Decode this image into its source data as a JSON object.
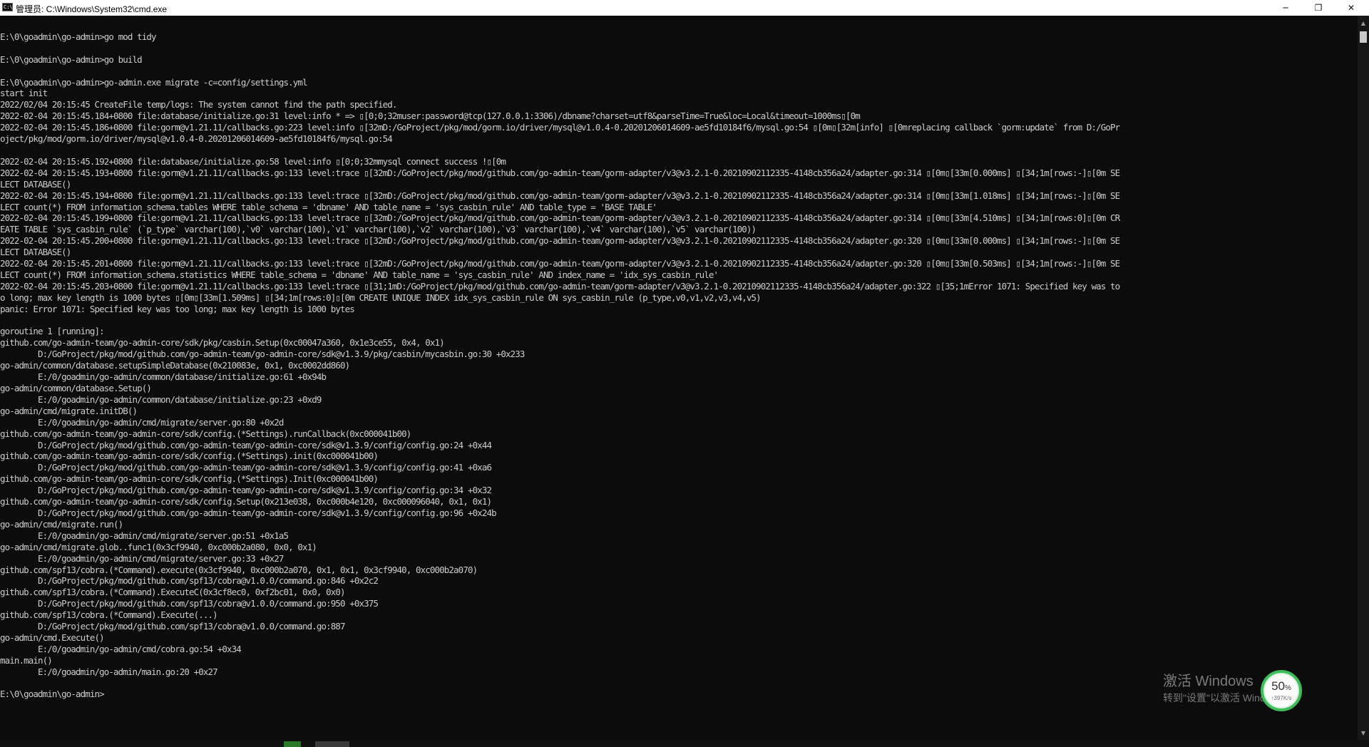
{
  "window": {
    "title": "管理员: C:\\Windows\\System32\\cmd.exe",
    "icon": "cmd-icon",
    "icon_text": "C:\\",
    "controls": {
      "minimize": "─",
      "maximize": "❐",
      "close": "✕"
    }
  },
  "console": {
    "lines": [
      "",
      "E:\\0\\goadmin\\go-admin>go mod tidy",
      "",
      "E:\\0\\goadmin\\go-admin>go build",
      "",
      "E:\\0\\goadmin\\go-admin>go-admin.exe migrate -c=config/settings.yml",
      "start init",
      "2022/02/04 20:15:45 CreateFile temp/logs: The system cannot find the path specified.",
      "2022-02-04 20:15:45.184+0800 file:database/initialize.go:31 level:info * => \u001b[0;0;32muser:password@tcp(127.0.0.1:3306)/dbname?charset=utf8&parseTime=True&loc=Local&timeout=1000ms\u001b[0m",
      "2022-02-04 20:15:45.186+0800 file:gorm@v1.21.11/callbacks.go:223 level:info \u001b[32mD:/GoProject/pkg/mod/gorm.io/driver/mysql@v1.0.4-0.20201206014609-ae5fd10184f6/mysql.go:54 \u001b[0m\u001b[32m[info] \u001b[0mreplacing callback `gorm:update` from D:/GoPr",
      "oject/pkg/mod/gorm.io/driver/mysql@v1.0.4-0.20201206014609-ae5fd10184f6/mysql.go:54",
      "",
      "2022-02-04 20:15:45.192+0800 file:database/initialize.go:58 level:info \u001b[0;0;32mmysql connect success !\u001b[0m",
      "2022-02-04 20:15:45.193+0800 file:gorm@v1.21.11/callbacks.go:133 level:trace \u001b[32mD:/GoProject/pkg/mod/github.com/go-admin-team/gorm-adapter/v3@v3.2.1-0.20210902112335-4148cb356a24/adapter.go:314 \u001b[0m\u001b[33m[0.000ms] \u001b[34;1m[rows:-]\u001b[0m SE",
      "LECT DATABASE()",
      "2022-02-04 20:15:45.194+0800 file:gorm@v1.21.11/callbacks.go:133 level:trace \u001b[32mD:/GoProject/pkg/mod/github.com/go-admin-team/gorm-adapter/v3@v3.2.1-0.20210902112335-4148cb356a24/adapter.go:314 \u001b[0m\u001b[33m[1.018ms] \u001b[34;1m[rows:-]\u001b[0m SE",
      "LECT count(*) FROM information_schema.tables WHERE table_schema = 'dbname' AND table_name = 'sys_casbin_rule' AND table_type = 'BASE TABLE'",
      "2022-02-04 20:15:45.199+0800 file:gorm@v1.21.11/callbacks.go:133 level:trace \u001b[32mD:/GoProject/pkg/mod/github.com/go-admin-team/gorm-adapter/v3@v3.2.1-0.20210902112335-4148cb356a24/adapter.go:314 \u001b[0m\u001b[33m[4.510ms] \u001b[34;1m[rows:0]\u001b[0m CR",
      "EATE TABLE `sys_casbin_rule` (`p_type` varchar(100),`v0` varchar(100),`v1` varchar(100),`v2` varchar(100),`v3` varchar(100),`v4` varchar(100),`v5` varchar(100))",
      "2022-02-04 20:15:45.200+0800 file:gorm@v1.21.11/callbacks.go:133 level:trace \u001b[32mD:/GoProject/pkg/mod/github.com/go-admin-team/gorm-adapter/v3@v3.2.1-0.20210902112335-4148cb356a24/adapter.go:320 \u001b[0m\u001b[33m[0.000ms] \u001b[34;1m[rows:-]\u001b[0m SE",
      "LECT DATABASE()",
      "2022-02-04 20:15:45.201+0800 file:gorm@v1.21.11/callbacks.go:133 level:trace \u001b[32mD:/GoProject/pkg/mod/github.com/go-admin-team/gorm-adapter/v3@v3.2.1-0.20210902112335-4148cb356a24/adapter.go:320 \u001b[0m\u001b[33m[0.503ms] \u001b[34;1m[rows:-]\u001b[0m SE",
      "LECT count(*) FROM information_schema.statistics WHERE table_schema = 'dbname' AND table_name = 'sys_casbin_rule' AND index_name = 'idx_sys_casbin_rule'",
      "2022-02-04 20:15:45.203+0800 file:gorm@v1.21.11/callbacks.go:133 level:trace \u001b[31;1mD:/GoProject/pkg/mod/github.com/go-admin-team/gorm-adapter/v3@v3.2.1-0.20210902112335-4148cb356a24/adapter.go:322 \u001b[35;1mError 1071: Specified key was to",
      "o long; max key length is 1000 bytes \u001b[0m\u001b[33m[1.509ms] \u001b[34;1m[rows:0]\u001b[0m CREATE UNIQUE INDEX idx_sys_casbin_rule ON sys_casbin_rule (p_type,v0,v1,v2,v3,v4,v5)",
      "panic: Error 1071: Specified key was too long; max key length is 1000 bytes",
      "",
      "goroutine 1 [running]:",
      "github.com/go-admin-team/go-admin-core/sdk/pkg/casbin.Setup(0xc00047a360, 0x1e3ce55, 0x4, 0x1)",
      "        D:/GoProject/pkg/mod/github.com/go-admin-team/go-admin-core/sdk@v1.3.9/pkg/casbin/mycasbin.go:30 +0x233",
      "go-admin/common/database.setupSimpleDatabase(0x210083e, 0x1, 0xc0002dd860)",
      "        E:/0/goadmin/go-admin/common/database/initialize.go:61 +0x94b",
      "go-admin/common/database.Setup()",
      "        E:/0/goadmin/go-admin/common/database/initialize.go:23 +0xd9",
      "go-admin/cmd/migrate.initDB()",
      "        E:/0/goadmin/go-admin/cmd/migrate/server.go:80 +0x2d",
      "github.com/go-admin-team/go-admin-core/sdk/config.(*Settings).runCallback(0xc000041b00)",
      "        D:/GoProject/pkg/mod/github.com/go-admin-team/go-admin-core/sdk@v1.3.9/config/config.go:24 +0x44",
      "github.com/go-admin-team/go-admin-core/sdk/config.(*Settings).init(0xc000041b00)",
      "        D:/GoProject/pkg/mod/github.com/go-admin-team/go-admin-core/sdk@v1.3.9/config/config.go:41 +0xa6",
      "github.com/go-admin-team/go-admin-core/sdk/config.(*Settings).Init(0xc000041b00)",
      "        D:/GoProject/pkg/mod/github.com/go-admin-team/go-admin-core/sdk@v1.3.9/config/config.go:34 +0x32",
      "github.com/go-admin-team/go-admin-core/sdk/config.Setup(0x213e038, 0xc000b4e120, 0xc000096040, 0x1, 0x1)",
      "        D:/GoProject/pkg/mod/github.com/go-admin-team/go-admin-core/sdk@v1.3.9/config/config.go:96 +0x24b",
      "go-admin/cmd/migrate.run()",
      "        E:/0/goadmin/go-admin/cmd/migrate/server.go:51 +0x1a5",
      "go-admin/cmd/migrate.glob..func1(0x3cf9940, 0xc000b2a080, 0x0, 0x1)",
      "        E:/0/goadmin/go-admin/cmd/migrate/server.go:33 +0x27",
      "github.com/spf13/cobra.(*Command).execute(0x3cf9940, 0xc000b2a070, 0x1, 0x1, 0x3cf9940, 0xc000b2a070)",
      "        D:/GoProject/pkg/mod/github.com/spf13/cobra@v1.0.0/command.go:846 +0x2c2",
      "github.com/spf13/cobra.(*Command).ExecuteC(0x3cf8ec0, 0xf2bc01, 0x0, 0x0)",
      "        D:/GoProject/pkg/mod/github.com/spf13/cobra@v1.0.0/command.go:950 +0x375",
      "github.com/spf13/cobra.(*Command).Execute(...)",
      "        D:/GoProject/pkg/mod/github.com/spf13/cobra@v1.0.0/command.go:887",
      "go-admin/cmd.Execute()",
      "        E:/0/goadmin/go-admin/cmd/cobra.go:54 +0x34",
      "main.main()",
      "        E:/0/goadmin/go-admin/main.go:20 +0x27",
      "",
      "E:\\0\\goadmin\\go-admin>"
    ]
  },
  "scrollbar": {
    "up": "▲",
    "down": "▼"
  },
  "watermark": {
    "title": "激活 Windows",
    "subtitle": "转到\"设置\"以激活 Windows。"
  },
  "speed_widget": {
    "percent": "50",
    "percent_sign": "%",
    "rate": "↑397K/s"
  },
  "colors": {
    "background": "#0c0c0c",
    "text": "#cccccc",
    "titlebar": "#ffffff",
    "widget_ring": "#3cbf5a"
  }
}
